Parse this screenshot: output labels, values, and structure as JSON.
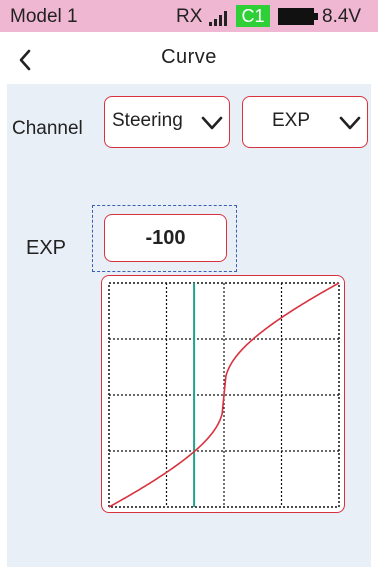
{
  "status": {
    "model_name": "Model 1",
    "rx_label": "RX",
    "channel_badge": "C1",
    "voltage": "8.4V",
    "signal_icon": "signal-bars-icon",
    "battery_icon": "battery-full-icon",
    "badge_color": "#2fd037"
  },
  "header": {
    "title": "Curve",
    "back_icon": "chevron-left-icon"
  },
  "channel": {
    "label": "Channel",
    "selected": "Steering",
    "curve_type": "EXP"
  },
  "exp": {
    "label": "EXP",
    "value": "-100"
  },
  "curve": {
    "grid_divisions": 4,
    "exp_value": -100,
    "input_position": 0.37,
    "curve_color": "#d9323f",
    "marker_color": "#1fa38a"
  },
  "colors": {
    "status_bar": "#f0b7d3",
    "content_bg": "#e8eff7",
    "accent_border": "#d9323f",
    "focus_frame": "#3a5fb5"
  }
}
